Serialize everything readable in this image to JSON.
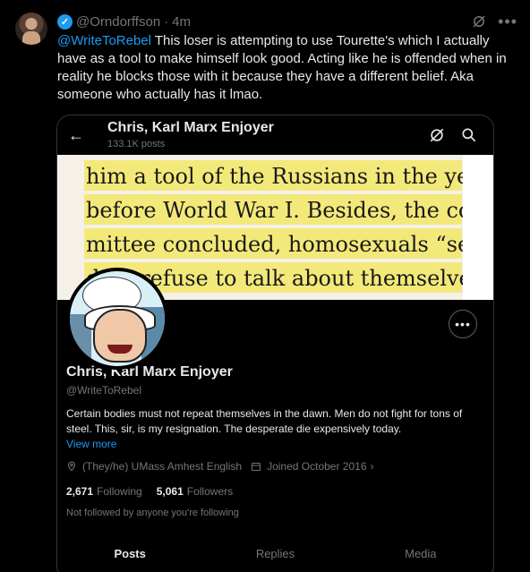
{
  "tweet": {
    "author_handle": "@Orndorffson",
    "separator": "·",
    "time": "4m",
    "mention": "@WriteToRebel",
    "body": " This loser is attempting to use Tourette's which I actually have as a tool to make himself look good. Acting like he is offended when in reality he blocks those with it because they have a different belief. Aka someone who actually has it lmao."
  },
  "card": {
    "back_icon": "arrow-left-icon",
    "title": "Chris, Karl Marx Enjoyer",
    "posts_count": "133.1K posts",
    "banner_lines": [
      "him a tool of the Russians in the years",
      "before World War I. Besides, the com-",
      "mittee concluded, homosexuals “sel-",
      "dom refuse to talk about themselves,”"
    ],
    "profile": {
      "name": "Chris, Karl Marx Enjoyer",
      "handle": "@WriteToRebel",
      "bio": "Certain bodies must not repeat themselves in the dawn. Men do not fight for tons of steel. This, sir, is my resignation. The desperate die expensively today.",
      "view_more": "View more",
      "location": "(They/he) UMass Amhest English",
      "joined": "Joined October 2016",
      "chevron": "›",
      "following_count": "2,671",
      "following_label": "Following",
      "followers_count": "5,061",
      "followers_label": "Followers",
      "not_followed": "Not followed by anyone you're following"
    },
    "tabs": [
      {
        "label": "Posts",
        "active": true
      },
      {
        "label": "Replies",
        "active": false
      },
      {
        "label": "Media",
        "active": false
      }
    ]
  },
  "colors": {
    "accent": "#1d9bf0",
    "text_primary": "#e7e9ea",
    "text_secondary": "#71767b",
    "highlight": "#f3e97a"
  }
}
